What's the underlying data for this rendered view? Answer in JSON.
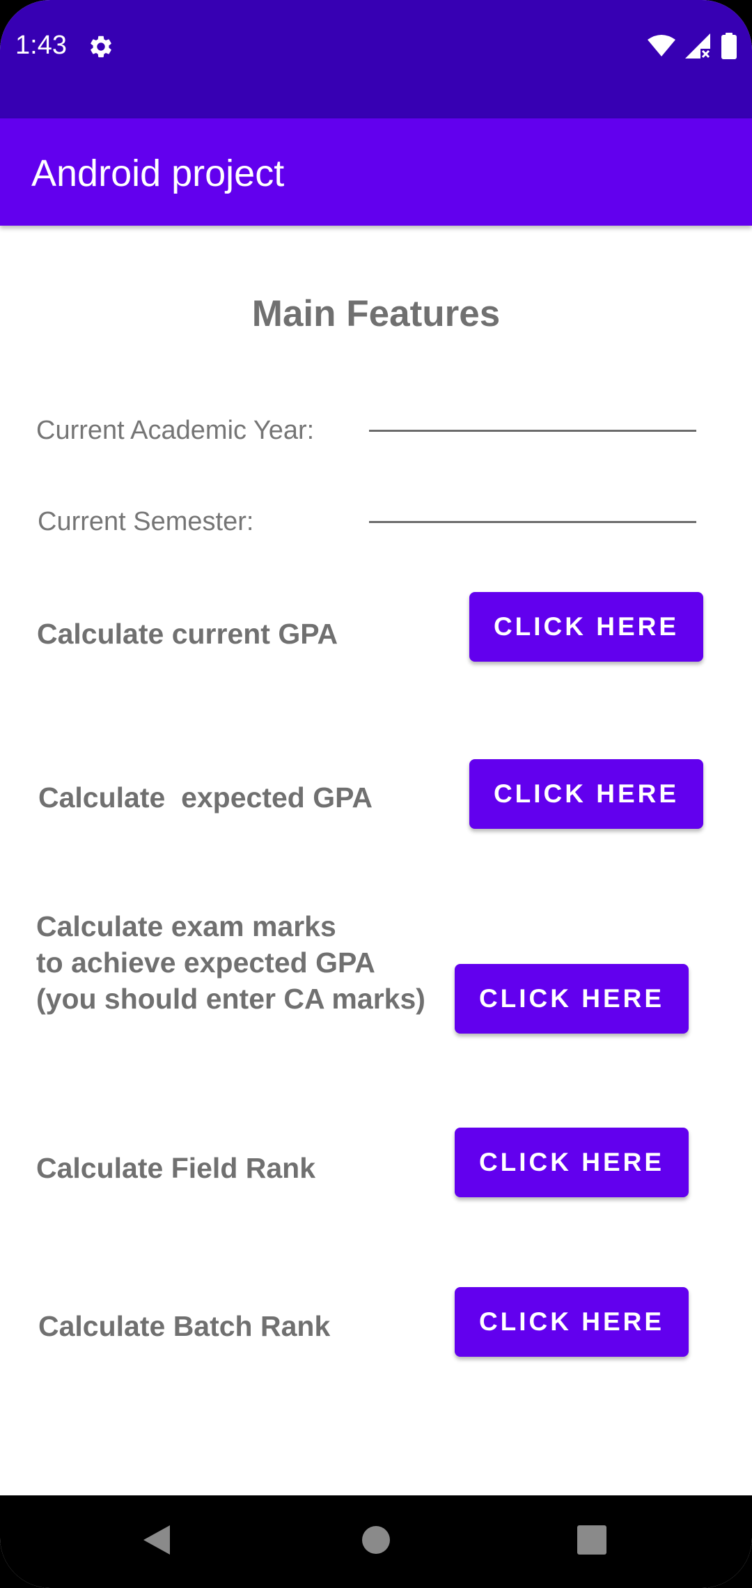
{
  "status_bar": {
    "time": "1:43",
    "icons": [
      "gear-icon",
      "wifi-icon",
      "signal-icon",
      "battery-icon"
    ],
    "color": "#3700B3"
  },
  "app_bar": {
    "title": "Android project",
    "color": "#6200EE"
  },
  "main": {
    "heading": "Main Features",
    "fields": [
      {
        "label": "Current Academic Year:",
        "value": ""
      },
      {
        "label": "Current Semester:",
        "value": ""
      }
    ],
    "features": [
      {
        "label": "Calculate current GPA",
        "button": "CLICK HERE"
      },
      {
        "label": "Calculate  expected GPA",
        "button": "CLICK HERE"
      },
      {
        "label_lines": [
          "Calculate exam marks",
          "to achieve expected GPA",
          "(you should enter CA marks)"
        ],
        "button": "CLICK HERE"
      },
      {
        "label": "Calculate Field Rank",
        "button": "CLICK HERE"
      },
      {
        "label": "Calculate Batch Rank",
        "button": "CLICK HERE"
      }
    ],
    "button_color": "#6200EE"
  },
  "nav_bar": {
    "icons": [
      "back-icon",
      "home-icon",
      "recents-icon"
    ]
  }
}
